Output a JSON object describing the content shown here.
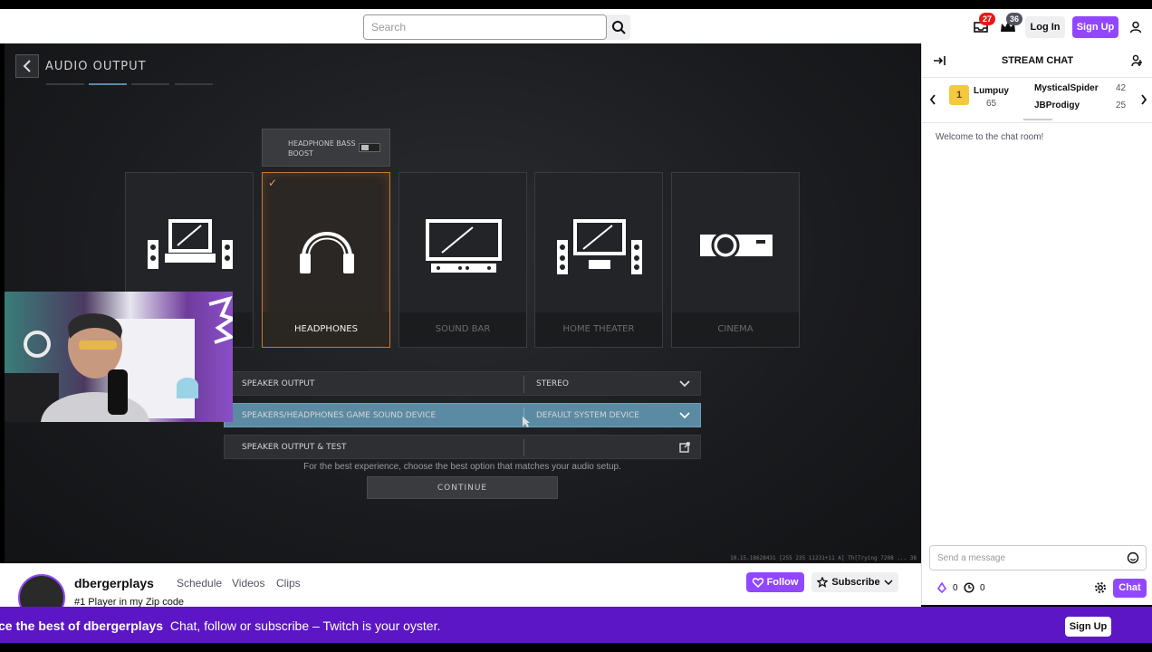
{
  "topnav": {
    "search_placeholder": "Search",
    "notifications_count": "27",
    "whispers_count": "36",
    "login_label": "Log In",
    "signup_label": "Sign Up"
  },
  "game": {
    "title": "AUDIO OUTPUT",
    "bass_boost_label": "HEADPHONE BASS BOOST",
    "cards": [
      {
        "label": "",
        "icon": "tv-speakers-icon",
        "selected": false
      },
      {
        "label": "HEADPHONES",
        "icon": "headphones-icon",
        "selected": true
      },
      {
        "label": "SOUND BAR",
        "icon": "soundbar-icon",
        "selected": false
      },
      {
        "label": "HOME THEATER",
        "icon": "home-theater-icon",
        "selected": false
      },
      {
        "label": "CINEMA",
        "icon": "projector-icon",
        "selected": false
      }
    ],
    "rows": [
      {
        "label": "SPEAKER OUTPUT",
        "value": "STEREO"
      },
      {
        "label": "SPEAKERS/HEADPHONES GAME SOUND DEVICE",
        "value": "DEFAULT SYSTEM DEVICE"
      },
      {
        "label": "SPEAKER OUTPUT & TEST",
        "value": ""
      }
    ],
    "hint": "For the best experience, choose the best option that matches your audio setup.",
    "continue_label": "CONTINUE",
    "debug_text": "10.15.18628431 [255 235 11231+11 A] Th[Trying 7208 ... 38"
  },
  "channel": {
    "name": "dbergerplays",
    "links": [
      "Schedule",
      "Videos",
      "Clips"
    ],
    "stream_title": "#1 Player in my Zip code",
    "follow_label": "Follow",
    "subscribe_label": "Subscribe"
  },
  "chat": {
    "title": "STREAM CHAT",
    "leaderboard": [
      {
        "name": "Lumpuy",
        "count": "65"
      },
      {
        "name": "MysticalSpider",
        "count": "42"
      },
      {
        "name": "JBProdigy",
        "count": "25"
      }
    ],
    "welcome": "Welcome to the chat room!",
    "input_placeholder": "Send a message",
    "points_a": "0",
    "points_b": "0",
    "chat_button": "Chat"
  },
  "banner": {
    "text": "ce the best of dbergerplays",
    "text_tail": "Chat, follow or subscribe – Twitch is your oyster.",
    "button": "Sign Up"
  },
  "colors": {
    "brand": "#9147ff",
    "banner": "#5c16c5",
    "selected_card": "#c47a30",
    "active_row": "#5b8aa3"
  }
}
